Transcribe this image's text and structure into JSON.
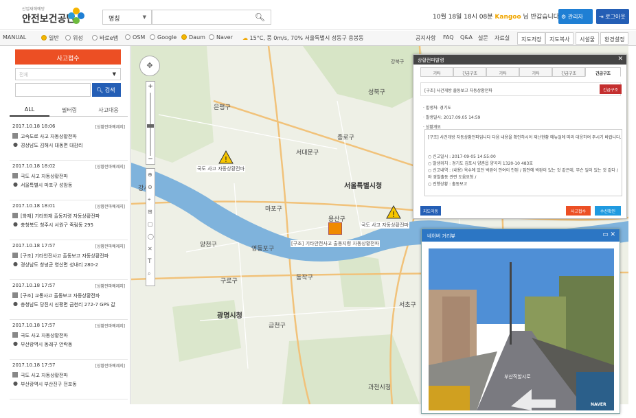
{
  "header": {
    "logo_sub": "산업재해예방",
    "logo_title": "안전보건공단",
    "category_select": "명칭",
    "greeting_prefix": "10월 18일 18시 08분",
    "user_name": "Kangoo",
    "greeting_suffix": "님 반갑습니다.",
    "admin_button": "관리자",
    "logout_button": "로그아웃"
  },
  "toolbar": {
    "mode": "MANUAL",
    "radios": [
      {
        "label": "일반",
        "on": true
      },
      {
        "label": "위성",
        "on": false
      },
      {
        "label": "바로e맵",
        "on": false
      },
      {
        "label": "OSM",
        "on": false
      },
      {
        "label": "Google",
        "on": false
      },
      {
        "label": "Daum",
        "on": true
      },
      {
        "label": "Naver",
        "on": false
      }
    ],
    "weather": "15°C, 풍 0m/s, 70% 서울특별시 성동구 용봉동",
    "links": [
      "공지사항",
      "FAQ",
      "Q&A",
      "설문",
      "자료실"
    ],
    "buttons": [
      "지도저장",
      "지도복사",
      "시설물",
      "환경설정"
    ]
  },
  "left": {
    "report_button": "사고접수",
    "filter_placeholder": "전체",
    "search_button": "검색",
    "tabs": [
      "ALL",
      "필터링",
      "사고대응"
    ],
    "items": [
      {
        "date": "2017.10.18 18:06",
        "status": "[상황전파예제지]",
        "title": "고속도로 사고 자동상황전파",
        "place": "경상남도 김해시 대동면 대감리"
      },
      {
        "date": "2017.10.18 18:02",
        "status": "[상황전파예제지]",
        "title": "국도 사고 자동상황전파",
        "place": "서울특별시 마포구 성암동"
      },
      {
        "date": "2017.10.18 18:01",
        "status": "[상황전파예제지]",
        "title": "[화재] 기타화재 출동지령 자동상황전파",
        "place": "충청북도 청주시 서원구 죽림동 295"
      },
      {
        "date": "2017.10.18 17:57",
        "status": "[상황전파예제지]",
        "title": "[구조] 기타안전사고 출동보고 자동상황전파",
        "place": "경상남도 창녕군 영산면 성내리 280-2"
      },
      {
        "date": "2017.10.18 17:57",
        "status": "[상황전파예제지]",
        "title": "[구조] 교통사고 출동보고 자동상황전파",
        "place": "충청남도 당진시 신평면 금천리 272-7 GPS 값"
      },
      {
        "date": "2017.10.18 17:57",
        "status": "[상황전파예제지]",
        "title": "국도 사고 자동상황전파",
        "place": "부산광역시 동래구 안락동"
      },
      {
        "date": "2017.10.18 17:57",
        "status": "[상황전파예제지]",
        "title": "국도 사고 자동상황전파",
        "place": "부산광역시 부산진구 전포동"
      }
    ]
  },
  "map": {
    "labels": {
      "gangbuk": "강북구",
      "seodaemun": "서대문구",
      "jongno": "종로구",
      "seongbuk": "성북구",
      "seoul_city_hall": "서울특별시청",
      "mapo": "마포구",
      "yangcheon": "양천구",
      "gangseo": "강서구",
      "guro": "구로구",
      "geumcheon": "금천구",
      "gwangmyeong": "광명시청",
      "dongjak": "동작구",
      "gwacheon": "과천시청",
      "eunpyeong": "은평구",
      "yongsan": "용산구",
      "yeongdeungpo": "영등포구",
      "seocho": "서초구",
      "incident_1": "국도 사고 자동상황전파",
      "incident_2": "[구조] 기타안전사고 출동지령 자동상황전파",
      "incident_3": "국도 사고 자동상황전파"
    }
  },
  "dialog": {
    "title": "상황전파발령",
    "tabs": [
      "기타",
      "긴급구조",
      "기타",
      "기타",
      "긴급구조",
      "긴급구조"
    ],
    "headline": "[구조] 사건개방 출동보고 자동상황전파",
    "status_badge": "긴급구조",
    "occur_place": "· 발생처: 경기도",
    "occur_time": "· 발생일시: 2017.09.05 14:59",
    "content_label": "· 상황개요",
    "body_lines": [
      "[구조] 사건개방 자동상황전파입니다 다음 내용을 확인하시어 재난현황 매뉴얼에 따라 대응하여 주시기 바랍니다.",
      "○ 신고일시 : 2017-09-05 14:55:00",
      "○ 발생위치 : 경기도 김포시 양촌읍 양곡리 1320-10 483호",
      "○ 신고내역 : (내용) 옥수에 있던 박완이 안여이 안된 / 집안에 박완이 있는 것 같은데, 무슨 일이 있는 것 같다 /",
      "   와 경찰출동 관련 도움요청 /",
      "○ 진행상황 : 출동보고"
    ],
    "list_button": "지도이동",
    "receive_button": "사고접수",
    "edit_button": "수신확인"
  },
  "roadview": {
    "title": "네이버 거리뷰",
    "caption": "부산직할시로",
    "brand": "NAVER"
  }
}
